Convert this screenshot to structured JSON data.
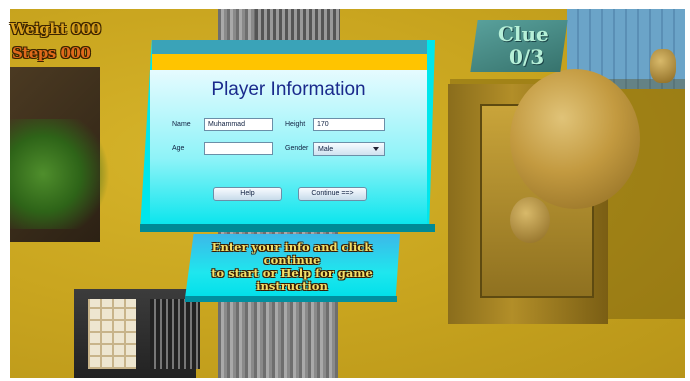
{
  "hud": {
    "weight": "Weight 000",
    "steps": "Steps 000",
    "clue_title": "Clue",
    "clue_count": "0/3"
  },
  "dialog": {
    "title": "Player Information",
    "name_label": "Name",
    "name_value": "Muhammad",
    "height_label": "Height",
    "height_value": "170",
    "age_label": "Age",
    "age_value": "",
    "gender_label": "Gender",
    "gender_value": "Male",
    "help_button": "Help",
    "continue_button": "Continue ==>"
  },
  "message": {
    "line1": "Enter your info and click continue",
    "line2": "to start or Help for game",
    "line3": "instruction"
  },
  "colors": {
    "panel": "#00e6ec",
    "banner": "#ffc400",
    "title": "#1a2a8c",
    "scene": "#c8a61f"
  }
}
